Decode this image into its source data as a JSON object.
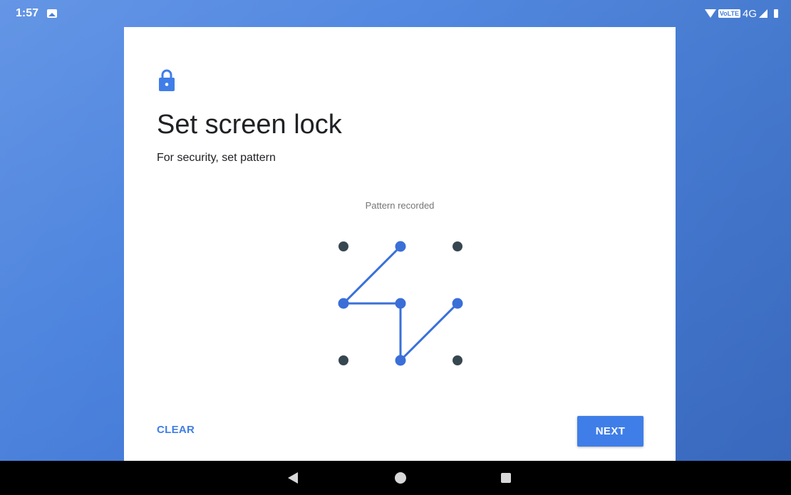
{
  "status_bar": {
    "time": "1:57",
    "network_badge": "VoLTE",
    "network_type": "4G",
    "icons": [
      "gallery-icon",
      "wifi-icon",
      "signal-icon",
      "battery-icon"
    ]
  },
  "card": {
    "title": "Set screen lock",
    "subtitle": "For security, set pattern",
    "pattern_status": "Pattern recorded",
    "clear_label": "CLEAR",
    "next_label": "NEXT"
  },
  "pattern": {
    "grid": [
      [
        1,
        2,
        3
      ],
      [
        4,
        5,
        6
      ],
      [
        7,
        8,
        9
      ]
    ],
    "sequence": [
      2,
      4,
      5,
      8,
      6
    ],
    "active_color": "#3a6fd8",
    "inactive_color": "#37474f"
  },
  "navigation": {
    "buttons": [
      "back-icon",
      "home-icon",
      "recents-icon"
    ]
  },
  "colors": {
    "accent": "#3f7ee8",
    "background": "#4a80dc",
    "card": "#ffffff"
  }
}
